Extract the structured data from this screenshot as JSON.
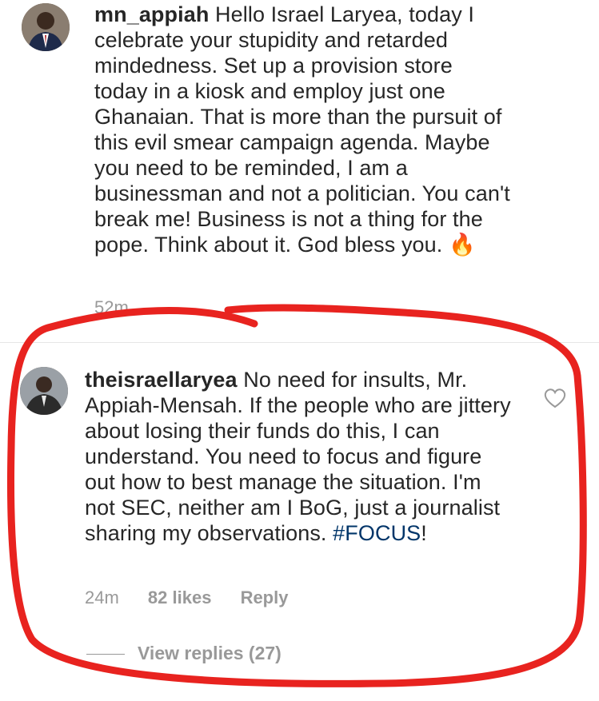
{
  "comments": [
    {
      "username": "mn_appiah",
      "text": "Hello Israel Laryea, today I celebrate your stupidity and retarded mindedness. Set up a provision store today in a kiosk and employ just one Ghanaian. That is more than the pursuit of this evil smear campaign agenda. Maybe you need to be reminded, I am a businessman and not a politician. You can't break me! Business is not a thing for the pope. Think about it. God bless you.",
      "emoji": "🔥",
      "timestamp": "52m"
    },
    {
      "username": "theisraellaryea",
      "text": "No need for insults, Mr. Appiah-Mensah. If the people who are jittery about losing their funds do this, I can understand. You need to focus and figure out how to best manage the situation. I'm not SEC, neither am I BoG, just a journalist sharing my observations.",
      "hashtag": "#FOCUS",
      "trailing": "!",
      "timestamp": "24m",
      "likes": "82 likes",
      "reply_label": "Reply",
      "view_replies": "View replies (27)"
    }
  ],
  "colors": {
    "text": "#262626",
    "muted": "#999999",
    "hashtag": "#003569",
    "annotation": "#e8231f"
  }
}
